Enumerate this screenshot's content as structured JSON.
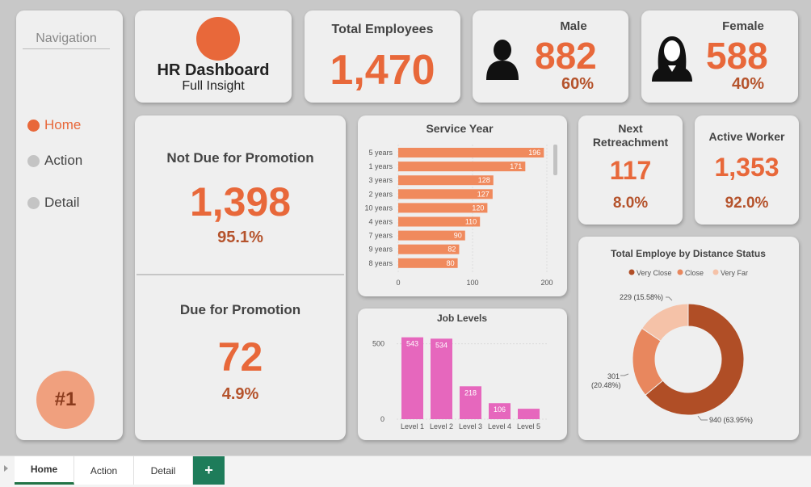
{
  "nav": {
    "title": "Navigation",
    "items": [
      {
        "label": "Home",
        "active": true
      },
      {
        "label": "Action",
        "active": false
      },
      {
        "label": "Detail",
        "active": false
      }
    ],
    "badge": "#1"
  },
  "header": {
    "title": "HR Dashboard",
    "subtitle": "Full Insight"
  },
  "kpis": {
    "total": {
      "label": "Total Employees",
      "value": "1,470"
    },
    "male": {
      "label": "Male",
      "value": "882",
      "pct": "60%"
    },
    "female": {
      "label": "Female",
      "value": "588",
      "pct": "40%"
    },
    "not_due": {
      "label": "Not Due for Promotion",
      "value": "1,398",
      "pct": "95.1%"
    },
    "due": {
      "label": "Due for Promotion",
      "value": "72",
      "pct": "4.9%"
    },
    "retreat": {
      "label_line1": "Next",
      "label_line2": "Retreachment",
      "value": "117",
      "pct": "8.0%"
    },
    "active": {
      "label": "Active Worker",
      "value": "1,353",
      "pct": "92.0%"
    }
  },
  "colors": {
    "accent": "#e8683a",
    "dark_accent": "#b5532c",
    "bar_orange": "#f08a5d",
    "bar_pink": "#e667bd",
    "donut_dark": "#b04e26",
    "donut_mid": "#e8875e",
    "donut_light": "#f5c2a8"
  },
  "chart_data": [
    {
      "type": "bar",
      "orientation": "horizontal",
      "title": "Service Year",
      "categories": [
        "5 years",
        "1 years",
        "3 years",
        "2 years",
        "10 years",
        "4 years",
        "7 years",
        "9 years",
        "8 years"
      ],
      "values": [
        196,
        171,
        128,
        127,
        120,
        110,
        90,
        82,
        80
      ],
      "xlim": [
        0,
        200
      ],
      "xticks": [
        "0",
        "100",
        "200"
      ],
      "color": "#f08a5d"
    },
    {
      "type": "bar",
      "title": "Job Levels",
      "categories": [
        "Level 1",
        "Level 2",
        "Level 3",
        "Level 4",
        "Level 5"
      ],
      "values": [
        543,
        534,
        218,
        106,
        69
      ],
      "labels": [
        "543",
        "534",
        "218",
        "106",
        ""
      ],
      "ylim": [
        0,
        600
      ],
      "yticks": [
        "0",
        "500"
      ],
      "color": "#e667bd"
    },
    {
      "type": "pie",
      "donut": true,
      "title": "Total Employe by Distance Status",
      "legend": [
        "Very Close",
        "Close",
        "Very Far"
      ],
      "values": [
        940,
        301,
        229
      ],
      "labels": [
        "940 (63.95%)",
        "301",
        "(20.48%)",
        "229 (15.58%)"
      ],
      "colors": [
        "#b04e26",
        "#e8875e",
        "#f5c2a8"
      ]
    }
  ],
  "tabs": [
    {
      "label": "Home",
      "active": true
    },
    {
      "label": "Action",
      "active": false
    },
    {
      "label": "Detail",
      "active": false
    }
  ],
  "add_tab": "+"
}
